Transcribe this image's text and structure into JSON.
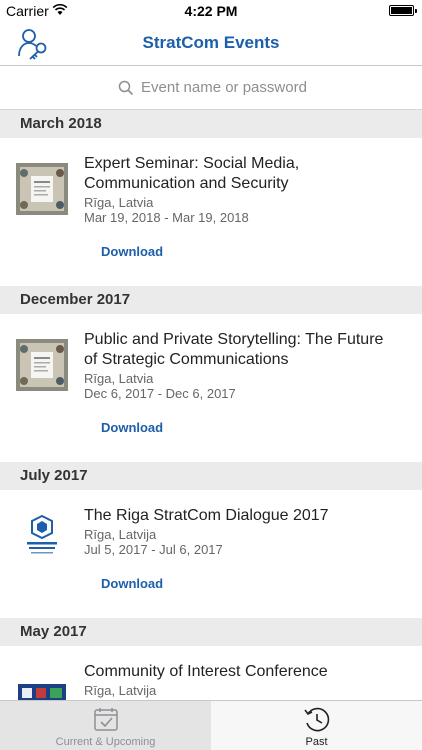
{
  "status": {
    "carrier": "Carrier",
    "time": "4:22 PM"
  },
  "nav": {
    "title": "StratCom Events",
    "icon": "key-user-icon"
  },
  "search": {
    "placeholder": "Event name or password"
  },
  "sections": [
    {
      "header": "March 2018",
      "events": [
        {
          "title_line1": "Expert Seminar: Social Media,",
          "title_line2": "Communication and Security",
          "location": "Rīga, Latvia",
          "dates": "Mar 19, 2018 - Mar 19, 2018",
          "download": "Download"
        }
      ]
    },
    {
      "header": "December 2017",
      "events": [
        {
          "title_line1": "Public and Private Storytelling: The Future",
          "title_line2": "of Strategic Communications",
          "location": "Rīga, Latvia",
          "dates": "Dec 6, 2017 - Dec 6, 2017",
          "download": "Download"
        }
      ]
    },
    {
      "header": "July 2017",
      "events": [
        {
          "title_line1": "The Riga StratCom Dialogue 2017",
          "location": "Rīga, Latvija",
          "dates": "Jul 5, 2017 - Jul 6, 2017",
          "download": "Download"
        }
      ]
    },
    {
      "header": "May 2017",
      "events": [
        {
          "title_line1": "Community of Interest Conference",
          "location": "Rīga, Latvija"
        }
      ]
    }
  ],
  "tabs": [
    {
      "label": "Current & Upcoming",
      "icon": "calendar-check-icon",
      "selected": false
    },
    {
      "label": "Past",
      "icon": "history-clock-icon",
      "selected": true
    }
  ],
  "colors": {
    "accent": "#1c5fab",
    "section_bg": "#ebebeb"
  }
}
